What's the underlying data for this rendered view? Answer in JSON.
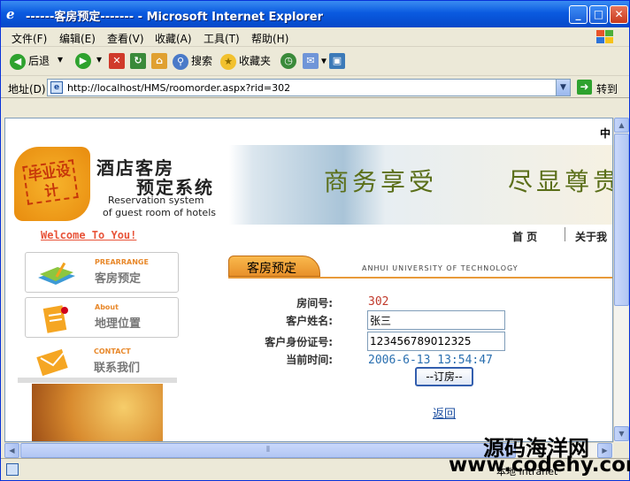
{
  "window": {
    "title": "------客房预定------- - Microsoft Internet Explorer"
  },
  "menu": [
    "文件(F)",
    "编辑(E)",
    "查看(V)",
    "收藏(A)",
    "工具(T)",
    "帮助(H)"
  ],
  "toolbar": {
    "back": "后退",
    "search": "搜索",
    "favorites": "收藏夹"
  },
  "address": {
    "label": "地址(D)",
    "url": "http://localhost/HMS/roomorder.aspx?rid=302",
    "go": "转到"
  },
  "page": {
    "lang_label": "中",
    "logo_text": "毕业设计",
    "banner_title_1": "酒店客房",
    "banner_title_2": "预定系统",
    "banner_en_1": "Reservation system",
    "banner_en_2": "of guest room of hotels",
    "slogan_1": "商务享受",
    "slogan_2": "尽显尊贵",
    "welcome": "Welcome To You!",
    "nav": [
      "首 页",
      "关于我"
    ],
    "side_menu": [
      {
        "en": "PREARRANGE",
        "cn": "客房预定"
      },
      {
        "en": "About",
        "cn": "地理位置"
      },
      {
        "en": "CONTACT",
        "cn": "联系我们"
      }
    ],
    "tab_title": "客房预定",
    "university": "ANHUI UNIVERSITY OF TECHNOLOGY",
    "form": {
      "room_label": "房间号:",
      "room_value": "302",
      "name_label": "客户姓名:",
      "name_value": "张三",
      "id_label": "客户身份证号:",
      "id_value": "123456789012325",
      "time_label": "当前时间:",
      "time_value": "2006-6-13 13:54:47",
      "submit": "--订房--",
      "back": "返回"
    }
  },
  "status": {
    "zone": "本地 Intranet"
  },
  "watermark": {
    "line1": "源码海洋网",
    "line2": "www.codehy.com"
  },
  "colors": {
    "title_bar": "#0a5ae0",
    "accent_orange": "#e8902a",
    "link_blue": "#1d4fa1",
    "room_red": "#c0392b"
  }
}
